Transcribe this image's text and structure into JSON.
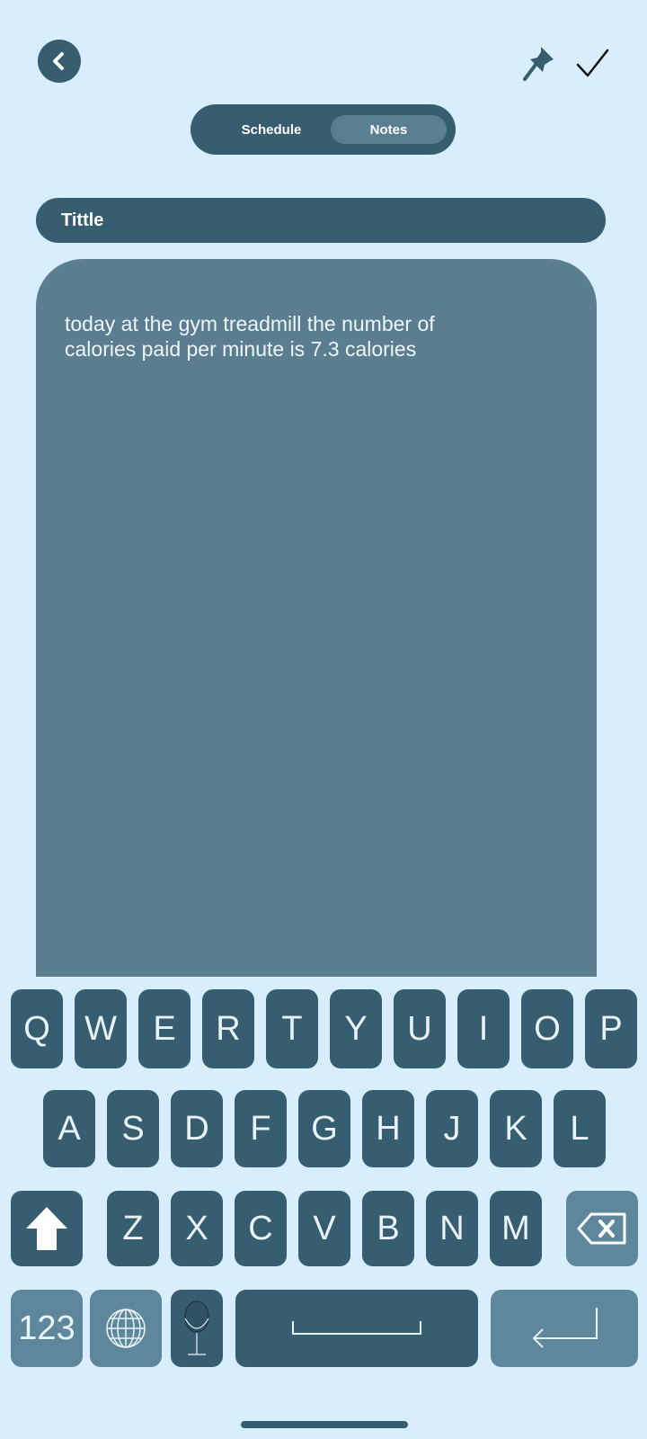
{
  "header": {
    "back_icon": "chevron-left-icon",
    "pin_icon": "pushpin-icon",
    "confirm_icon": "checkmark-icon"
  },
  "tabs": [
    {
      "label": "Schedule",
      "active": false
    },
    {
      "label": "Notes",
      "active": true
    }
  ],
  "note": {
    "title": "Tittle",
    "body": "today at the gym treadmill the number of\ncalories paid per minute is 7.3 calories"
  },
  "keyboard": {
    "row1": [
      "Q",
      "W",
      "E",
      "R",
      "T",
      "Y",
      "U",
      "I",
      "O",
      "P"
    ],
    "row2": [
      "A",
      "S",
      "D",
      "F",
      "G",
      "H",
      "J",
      "K",
      "L"
    ],
    "row3": [
      "Z",
      "X",
      "C",
      "V",
      "B",
      "N",
      "M"
    ],
    "numbers_label": "123",
    "icons": {
      "shift": "shift-arrow-icon",
      "backspace": "backspace-icon",
      "globe": "globe-icon",
      "mic": "microphone-icon",
      "space": "spacebar-icon",
      "enter": "return-icon"
    }
  },
  "colors": {
    "background": "#d8eefd",
    "primary": "#365d70",
    "secondary": "#5a7d90"
  }
}
